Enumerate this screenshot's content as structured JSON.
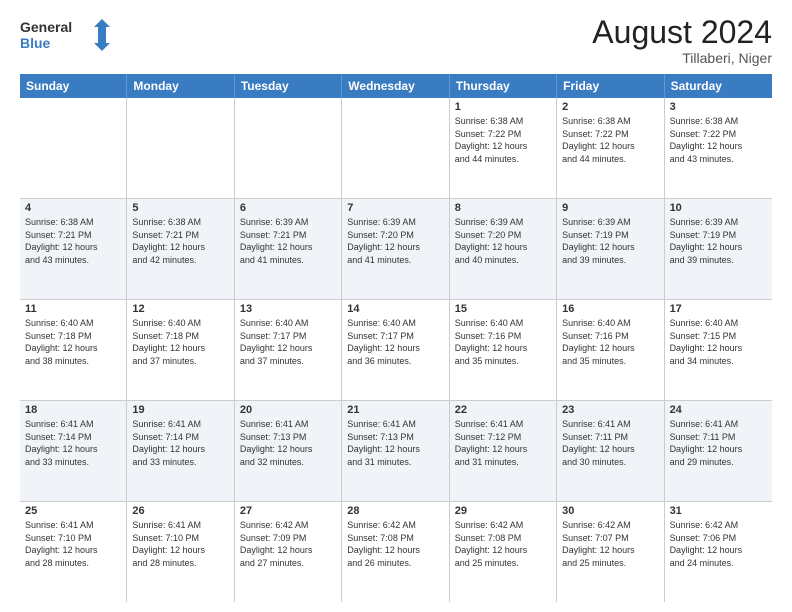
{
  "header": {
    "logo_line1": "General",
    "logo_line2": "Blue",
    "main_title": "August 2024",
    "subtitle": "Tillaberi, Niger"
  },
  "days_of_week": [
    "Sunday",
    "Monday",
    "Tuesday",
    "Wednesday",
    "Thursday",
    "Friday",
    "Saturday"
  ],
  "weeks": [
    [
      {
        "day": "",
        "info": ""
      },
      {
        "day": "",
        "info": ""
      },
      {
        "day": "",
        "info": ""
      },
      {
        "day": "",
        "info": ""
      },
      {
        "day": "1",
        "info": "Sunrise: 6:38 AM\nSunset: 7:22 PM\nDaylight: 12 hours\nand 44 minutes."
      },
      {
        "day": "2",
        "info": "Sunrise: 6:38 AM\nSunset: 7:22 PM\nDaylight: 12 hours\nand 44 minutes."
      },
      {
        "day": "3",
        "info": "Sunrise: 6:38 AM\nSunset: 7:22 PM\nDaylight: 12 hours\nand 43 minutes."
      }
    ],
    [
      {
        "day": "4",
        "info": "Sunrise: 6:38 AM\nSunset: 7:21 PM\nDaylight: 12 hours\nand 43 minutes."
      },
      {
        "day": "5",
        "info": "Sunrise: 6:38 AM\nSunset: 7:21 PM\nDaylight: 12 hours\nand 42 minutes."
      },
      {
        "day": "6",
        "info": "Sunrise: 6:39 AM\nSunset: 7:21 PM\nDaylight: 12 hours\nand 41 minutes."
      },
      {
        "day": "7",
        "info": "Sunrise: 6:39 AM\nSunset: 7:20 PM\nDaylight: 12 hours\nand 41 minutes."
      },
      {
        "day": "8",
        "info": "Sunrise: 6:39 AM\nSunset: 7:20 PM\nDaylight: 12 hours\nand 40 minutes."
      },
      {
        "day": "9",
        "info": "Sunrise: 6:39 AM\nSunset: 7:19 PM\nDaylight: 12 hours\nand 39 minutes."
      },
      {
        "day": "10",
        "info": "Sunrise: 6:39 AM\nSunset: 7:19 PM\nDaylight: 12 hours\nand 39 minutes."
      }
    ],
    [
      {
        "day": "11",
        "info": "Sunrise: 6:40 AM\nSunset: 7:18 PM\nDaylight: 12 hours\nand 38 minutes."
      },
      {
        "day": "12",
        "info": "Sunrise: 6:40 AM\nSunset: 7:18 PM\nDaylight: 12 hours\nand 37 minutes."
      },
      {
        "day": "13",
        "info": "Sunrise: 6:40 AM\nSunset: 7:17 PM\nDaylight: 12 hours\nand 37 minutes."
      },
      {
        "day": "14",
        "info": "Sunrise: 6:40 AM\nSunset: 7:17 PM\nDaylight: 12 hours\nand 36 minutes."
      },
      {
        "day": "15",
        "info": "Sunrise: 6:40 AM\nSunset: 7:16 PM\nDaylight: 12 hours\nand 35 minutes."
      },
      {
        "day": "16",
        "info": "Sunrise: 6:40 AM\nSunset: 7:16 PM\nDaylight: 12 hours\nand 35 minutes."
      },
      {
        "day": "17",
        "info": "Sunrise: 6:40 AM\nSunset: 7:15 PM\nDaylight: 12 hours\nand 34 minutes."
      }
    ],
    [
      {
        "day": "18",
        "info": "Sunrise: 6:41 AM\nSunset: 7:14 PM\nDaylight: 12 hours\nand 33 minutes."
      },
      {
        "day": "19",
        "info": "Sunrise: 6:41 AM\nSunset: 7:14 PM\nDaylight: 12 hours\nand 33 minutes."
      },
      {
        "day": "20",
        "info": "Sunrise: 6:41 AM\nSunset: 7:13 PM\nDaylight: 12 hours\nand 32 minutes."
      },
      {
        "day": "21",
        "info": "Sunrise: 6:41 AM\nSunset: 7:13 PM\nDaylight: 12 hours\nand 31 minutes."
      },
      {
        "day": "22",
        "info": "Sunrise: 6:41 AM\nSunset: 7:12 PM\nDaylight: 12 hours\nand 31 minutes."
      },
      {
        "day": "23",
        "info": "Sunrise: 6:41 AM\nSunset: 7:11 PM\nDaylight: 12 hours\nand 30 minutes."
      },
      {
        "day": "24",
        "info": "Sunrise: 6:41 AM\nSunset: 7:11 PM\nDaylight: 12 hours\nand 29 minutes."
      }
    ],
    [
      {
        "day": "25",
        "info": "Sunrise: 6:41 AM\nSunset: 7:10 PM\nDaylight: 12 hours\nand 28 minutes."
      },
      {
        "day": "26",
        "info": "Sunrise: 6:41 AM\nSunset: 7:10 PM\nDaylight: 12 hours\nand 28 minutes."
      },
      {
        "day": "27",
        "info": "Sunrise: 6:42 AM\nSunset: 7:09 PM\nDaylight: 12 hours\nand 27 minutes."
      },
      {
        "day": "28",
        "info": "Sunrise: 6:42 AM\nSunset: 7:08 PM\nDaylight: 12 hours\nand 26 minutes."
      },
      {
        "day": "29",
        "info": "Sunrise: 6:42 AM\nSunset: 7:08 PM\nDaylight: 12 hours\nand 25 minutes."
      },
      {
        "day": "30",
        "info": "Sunrise: 6:42 AM\nSunset: 7:07 PM\nDaylight: 12 hours\nand 25 minutes."
      },
      {
        "day": "31",
        "info": "Sunrise: 6:42 AM\nSunset: 7:06 PM\nDaylight: 12 hours\nand 24 minutes."
      }
    ]
  ]
}
